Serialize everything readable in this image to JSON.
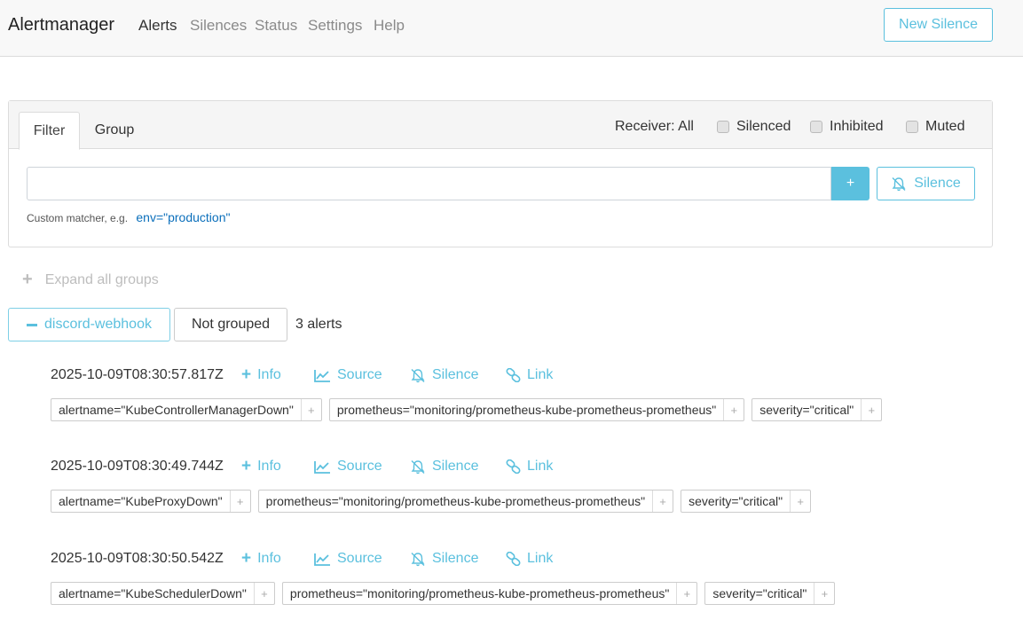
{
  "navbar": {
    "brand": "Alertmanager",
    "items": [
      {
        "label": "Alerts",
        "active": true
      },
      {
        "label": "Silences",
        "active": false
      },
      {
        "label": "Status",
        "active": false
      },
      {
        "label": "Settings",
        "active": false
      },
      {
        "label": "Help",
        "active": false
      }
    ],
    "new_silence": "New Silence"
  },
  "filter": {
    "tabs": [
      "Filter",
      "Group"
    ],
    "receiver": "Receiver: All",
    "checkboxes": [
      "Silenced",
      "Inhibited",
      "Muted"
    ],
    "input_value": "",
    "plus_label": "+",
    "silence_label": "Silence",
    "hint": "Custom matcher, e.g.",
    "hint_example": "env=\"production\""
  },
  "expand_all": "Expand all groups",
  "group": {
    "name": "discord-webhook",
    "not_grouped": "Not grouped",
    "count": "3 alerts"
  },
  "actions": {
    "info": "Info",
    "source": "Source",
    "silence": "Silence",
    "link": "Link",
    "label_plus": "+"
  },
  "alerts": [
    {
      "timestamp": "2025-10-09T08:30:57.817Z",
      "labels": [
        "alertname=\"KubeControllerManagerDown\"",
        "prometheus=\"monitoring/prometheus-kube-prometheus-prometheus\"",
        "severity=\"critical\""
      ]
    },
    {
      "timestamp": "2025-10-09T08:30:49.744Z",
      "labels": [
        "alertname=\"KubeProxyDown\"",
        "prometheus=\"monitoring/prometheus-kube-prometheus-prometheus\"",
        "severity=\"critical\""
      ]
    },
    {
      "timestamp": "2025-10-09T08:30:50.542Z",
      "labels": [
        "alertname=\"KubeSchedulerDown\"",
        "prometheus=\"monitoring/prometheus-kube-prometheus-prometheus\"",
        "severity=\"critical\""
      ]
    }
  ],
  "colors": {
    "accent": "#5bc0de",
    "link": "#0b6fbb",
    "navbar_bg": "#f8f8f8"
  }
}
